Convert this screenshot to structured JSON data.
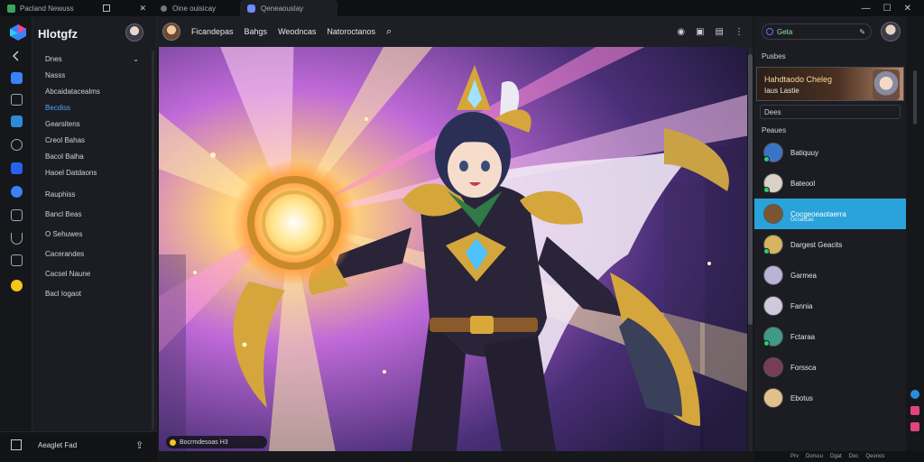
{
  "titlebar": {
    "tab1_label": "Pacland Newuss",
    "tab2_label": "Oine ouisicay",
    "tab3_label": "Qeneaouslay",
    "minimize": "—",
    "maximize": "☐",
    "close": "✕",
    "colors": {
      "tab1_dot": "#3aa55b",
      "tab3_icon": "#6d8cff"
    }
  },
  "sidebar": {
    "brand": "Hlotgfz",
    "items": [
      {
        "label": "Dnes"
      },
      {
        "label": "Nasss"
      },
      {
        "label": "Abcaidatacealms"
      },
      {
        "label": "Becdiss"
      },
      {
        "label": "Gearsitens"
      },
      {
        "label": "Creol Bahas"
      },
      {
        "label": "Bacol Balha"
      },
      {
        "label": "Haoel Datdaons"
      },
      {
        "label": "Rauphiss"
      },
      {
        "label": "Bancl Beas"
      },
      {
        "label": "O Sehuwes"
      },
      {
        "label": "Cacerandes"
      },
      {
        "label": "Cacsel Naune"
      },
      {
        "label": "Bacl Iogaot"
      }
    ],
    "active_index": 3,
    "bottom_label": "Aeaglet Fad"
  },
  "header": {
    "links": [
      "Ficandepas",
      "Bahgs",
      "Weodncas",
      "Natoroctanos"
    ],
    "icons": [
      "search-icon"
    ],
    "right_icons": [
      "help-icon",
      "window-icon",
      "panel-icon",
      "more-icon"
    ]
  },
  "canvas": {
    "caption": "Bocrmdesoas H3"
  },
  "rightpanel": {
    "search_text": "Geta",
    "section1": "Pusbes",
    "banner_title": "Hahdtaodo Cheleg",
    "banner_sub": "Iaus Lastie",
    "input_text": "Dees",
    "section2": "Peaues",
    "friends": [
      {
        "name": "Batiquuy",
        "status": "online",
        "color": "#3a74c9"
      },
      {
        "name": "Bateool",
        "status": "online",
        "color": "#d9d1c5"
      },
      {
        "name": "Cocgeoeaotaerra",
        "status": "active",
        "sub": "Ocrattcas",
        "color": "#7a5530"
      },
      {
        "name": "Dargest Geacits",
        "status": "online",
        "color": "#d7b560"
      },
      {
        "name": "Garmea",
        "status": "none",
        "color": "#b9b4d6"
      },
      {
        "name": "Fannia",
        "status": "none",
        "color": "#cfc8df"
      },
      {
        "name": "Fctaraa",
        "status": "online",
        "color": "#3f9a88"
      },
      {
        "name": "Forssca",
        "status": "none",
        "color": "#7a3b5a"
      },
      {
        "name": "Ebotus",
        "status": "none",
        "color": "#e2c08a"
      }
    ]
  },
  "statusbar": {
    "items": [
      "Prv",
      "Dorscu",
      "Dgat",
      "Doc",
      "Qeonos"
    ]
  },
  "colors": {
    "accent": "#29a3d9",
    "online": "#2ecc71",
    "bg": "#16181c"
  }
}
